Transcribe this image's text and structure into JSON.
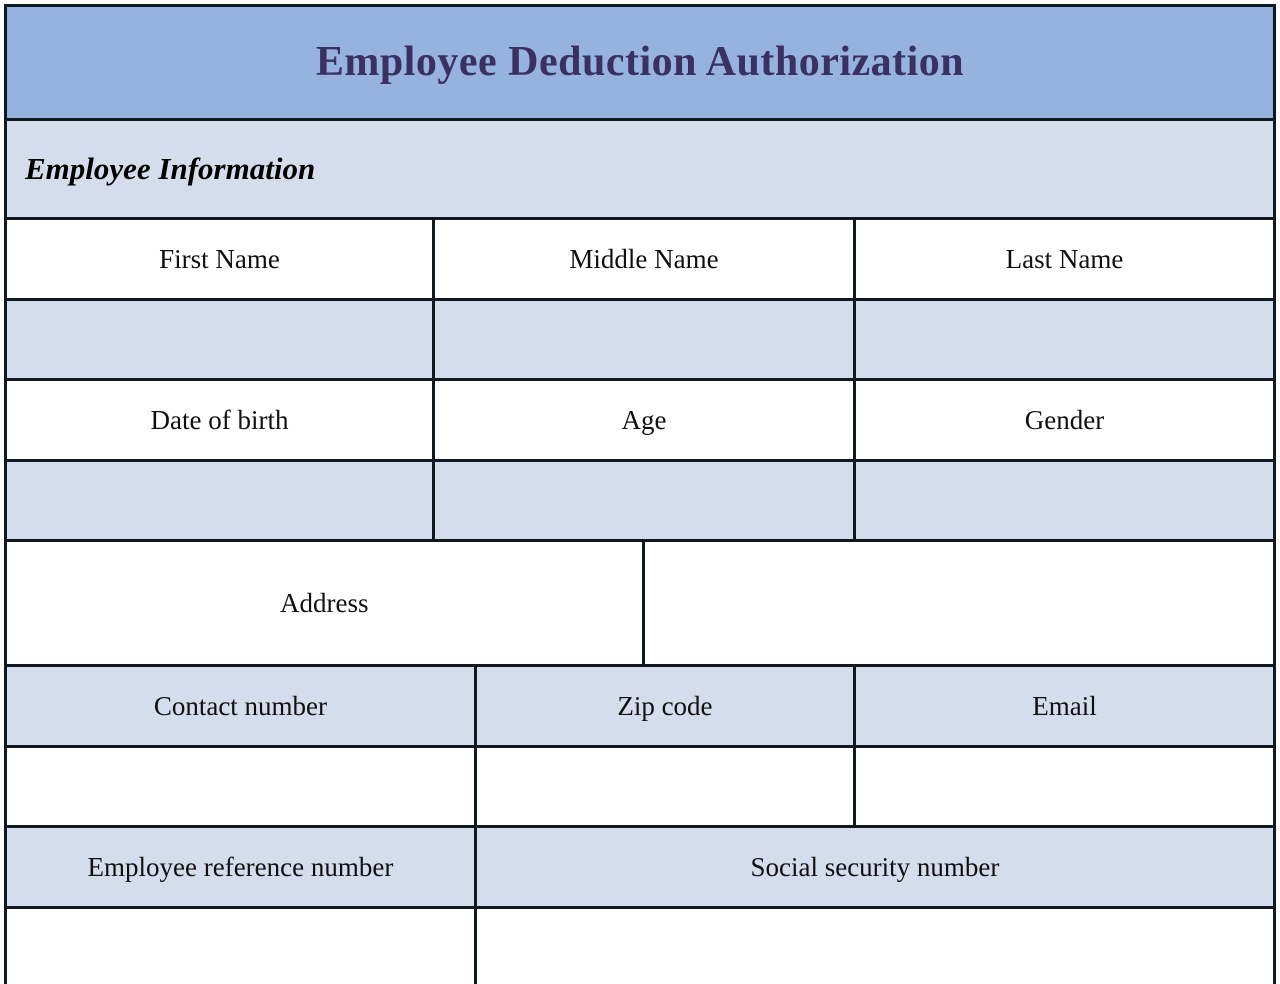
{
  "document": {
    "title": "Employee Deduction Authorization",
    "section_heading": "Employee Information"
  },
  "colors": {
    "header_banner": "#95B3DE",
    "field_fill": "#D5DCEB",
    "empty_fill": "#FFFFFF",
    "border": "#101820",
    "title_text": "#3B3062",
    "label_text": "#101010"
  },
  "fields": {
    "first_name": {
      "label": "First Name",
      "value": ""
    },
    "middle_name": {
      "label": "Middle Name",
      "value": ""
    },
    "last_name": {
      "label": "Last Name",
      "value": ""
    },
    "date_of_birth": {
      "label": "Date of birth",
      "value": ""
    },
    "age": {
      "label": "Age",
      "value": ""
    },
    "gender": {
      "label": "Gender",
      "value": ""
    },
    "address": {
      "label": "Address",
      "value": ""
    },
    "contact_number": {
      "label": "Contact number",
      "value": ""
    },
    "zip_code": {
      "label": "Zip code",
      "value": ""
    },
    "email": {
      "label": "Email",
      "value": ""
    },
    "employee_reference_number": {
      "label": "Employee reference number",
      "value": ""
    },
    "social_security_number": {
      "label": "Social security number",
      "value": ""
    }
  }
}
